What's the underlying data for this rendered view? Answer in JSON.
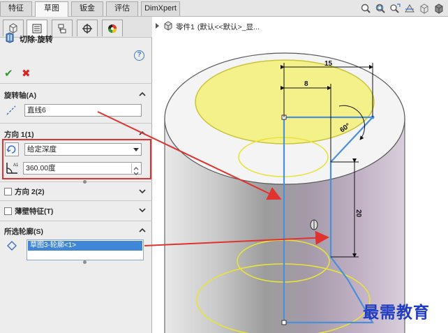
{
  "tabs": [
    {
      "label": "特征",
      "active": false
    },
    {
      "label": "草图",
      "active": true
    },
    {
      "label": "钣金",
      "active": false
    },
    {
      "label": "评估",
      "active": false
    },
    {
      "label": "DimXpert",
      "active": false
    }
  ],
  "view_tools": [
    "zoom-to-fit-icon",
    "zoom-area-icon",
    "previous-view-icon",
    "section-view-icon",
    "view-orientation-icon",
    "display-style-icon"
  ],
  "property_manager": {
    "tabs": [
      "feature-manager-icon",
      "property-manager-icon",
      "configuration-manager-icon",
      "dimxpert-manager-icon",
      "display-manager-icon"
    ],
    "feature_title": "切除-旋转",
    "help": "?",
    "axis": {
      "header": "旋转轴(A)",
      "value": "直线6"
    },
    "direction1": {
      "header": "方向 1(1)",
      "end_condition": "给定深度",
      "angle": "360.00度"
    },
    "direction2": {
      "header": "方向 2(2)",
      "checked": false
    },
    "thin_feature": {
      "header": "薄壁特征(T)",
      "checked": false
    },
    "selected_contours": {
      "header": "所选轮廓(S)",
      "items": [
        "草图3-轮廓<1>"
      ]
    }
  },
  "breadcrumb": {
    "part": "零件1",
    "config": "(默认<<默认>_显..."
  },
  "sketch_dims": {
    "width_top": "15",
    "width_inner": "8",
    "angle": "60°",
    "height": "20"
  },
  "watermark": "最需教育",
  "colors": {
    "accent": "#3f86d6",
    "annotation": "#e0322f",
    "sketch": "#4a90d9",
    "face_highlight": "#f4f08a",
    "watermark": "#1f3cc2"
  }
}
